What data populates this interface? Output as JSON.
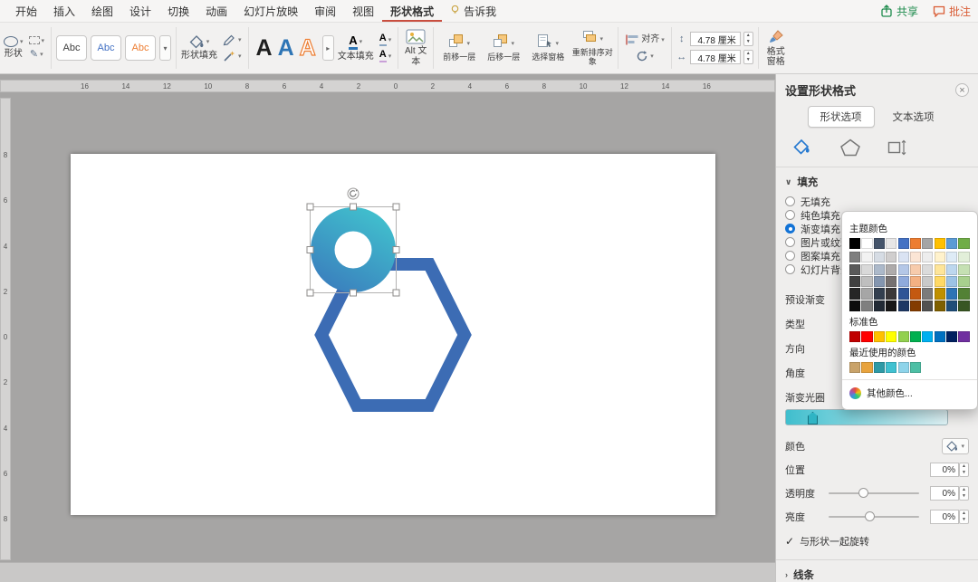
{
  "menubar": {
    "tabs": [
      "开始",
      "插入",
      "绘图",
      "设计",
      "切换",
      "动画",
      "幻灯片放映",
      "审阅",
      "视图",
      "形状格式",
      "告诉我"
    ],
    "active_tab": "形状格式",
    "share_label": "共享",
    "comments_label": "批注"
  },
  "ribbon": {
    "shapes_label": "形状",
    "style_gallery": [
      "Abc",
      "Abc",
      "Abc"
    ],
    "style_gallery_colors": [
      "#404040",
      "#4472C4",
      "#ED7D31"
    ],
    "shape_fill_label": "形状填充",
    "wordart_letters": [
      "A",
      "A",
      "A"
    ],
    "wordart_colors": [
      "#1F1F1F",
      "#2E75B5",
      "#ED7D31"
    ],
    "text_fill_label": "文本填充",
    "alt_text_label": "Alt 文本",
    "arrange_items": [
      "前移一层",
      "后移一层",
      "选择窗格",
      "重新排序对象"
    ],
    "align_label": "对齐",
    "height_value": "4.78 厘米",
    "width_value": "4.78 厘米",
    "format_pane_label": "格式窗格"
  },
  "rulers": {
    "horizontal": [
      "16",
      "14",
      "12",
      "10",
      "8",
      "6",
      "4",
      "2",
      "0",
      "2",
      "4",
      "6",
      "8",
      "10",
      "12",
      "14",
      "16"
    ],
    "vertical": [
      "8",
      "6",
      "4",
      "2",
      "0",
      "2",
      "4",
      "6",
      "8"
    ]
  },
  "canvas": {
    "donut": {
      "gradient_start": "#41C3CE",
      "gradient_end": "#3A7DBD"
    },
    "hexagon": {
      "color": "#3C6CB4"
    }
  },
  "panel": {
    "title": "设置形状格式",
    "tabs": [
      "形状选项",
      "文本选项"
    ],
    "active_tab": "形状选项",
    "fill_header": "填充",
    "fill_options": [
      "无填充",
      "纯色填充",
      "渐变填充",
      "图片或纹理填充",
      "图案填充",
      "幻灯片背景填充"
    ],
    "fill_selected": "渐变填充",
    "setting_rows": [
      "预设渐变",
      "类型",
      "方向",
      "角度"
    ],
    "gradient_stops_label": "渐变光圈",
    "gradient_bar_colors": [
      "#3FBECD",
      "#E2F5F8"
    ],
    "gradient_stop_color": "#2FB4C4",
    "color_label": "颜色",
    "position_label": "位置",
    "position_value": "0%",
    "transparency_label": "透明度",
    "transparency_value": "0%",
    "brightness_label": "亮度",
    "brightness_value": "0%",
    "rotate_with_shape_label": "与形状一起旋转",
    "line_header": "线条"
  },
  "color_picker": {
    "theme_label": "主题颜色",
    "standard_label": "标准色",
    "recent_label": "最近使用的颜色",
    "more_label": "其他颜色...",
    "theme_base": [
      "#000000",
      "#FFFFFF",
      "#44546A",
      "#E7E6E6",
      "#4472C4",
      "#ED7D31",
      "#A5A5A5",
      "#FFC000",
      "#5B9BD5",
      "#70AD47"
    ],
    "theme_shades": [
      [
        "#7F7F7F",
        "#F2F2F2",
        "#D6DCE4",
        "#D0CECE",
        "#DAE3F3",
        "#FBE5D5",
        "#EDEDED",
        "#FFF2CC",
        "#DEEBF6",
        "#E2EFD9"
      ],
      [
        "#595959",
        "#D9D9D9",
        "#ACB9CA",
        "#AEABAB",
        "#B4C7E7",
        "#F7CBAC",
        "#DBDBDB",
        "#FEE599",
        "#BDD7EE",
        "#C5E0B3"
      ],
      [
        "#404040",
        "#BFBFBF",
        "#8496B0",
        "#767171",
        "#8FAADC",
        "#F4B183",
        "#C9C9C9",
        "#FFD965",
        "#9CC3E5",
        "#A8D08D"
      ],
      [
        "#262626",
        "#A6A6A6",
        "#333F4F",
        "#3B3838",
        "#2F5496",
        "#C45911",
        "#7B7B7B",
        "#BF9000",
        "#2E74B5",
        "#538135"
      ],
      [
        "#0D0D0D",
        "#7F7F7F",
        "#222A35",
        "#181717",
        "#1F3864",
        "#833C00",
        "#525252",
        "#7F6000",
        "#1F4D78",
        "#385623"
      ]
    ],
    "standard": [
      "#C00000",
      "#FF0000",
      "#FFC000",
      "#FFFF00",
      "#92D050",
      "#00B050",
      "#00B0F0",
      "#0070C0",
      "#002060",
      "#7030A0"
    ],
    "recent": [
      "#C9A36A",
      "#E8A33D",
      "#2E9AA6",
      "#3FC1D1",
      "#8ED4EA",
      "#4DBFA5"
    ]
  }
}
